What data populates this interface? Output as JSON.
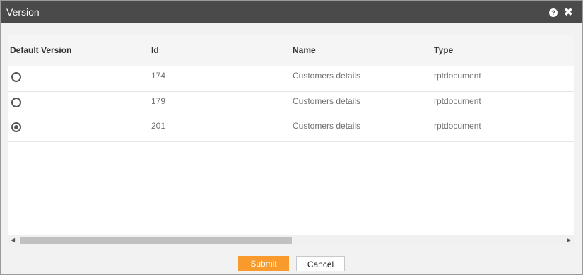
{
  "dialog": {
    "title": "Version",
    "help_glyph": "?",
    "close_glyph": "✖"
  },
  "table": {
    "columns": [
      "Default Version",
      "Id",
      "Name",
      "Type"
    ],
    "rows": [
      {
        "id": "174",
        "name": "Customers details",
        "type": "rptdocument",
        "default": false
      },
      {
        "id": "179",
        "name": "Customers details",
        "type": "rptdocument",
        "default": false
      },
      {
        "id": "201",
        "name": "Customers details",
        "type": "rptdocument",
        "default": true
      }
    ]
  },
  "scrollbar": {
    "left_arrow": "◀",
    "right_arrow": "▶"
  },
  "buttons": {
    "submit": "Submit",
    "cancel": "Cancel"
  },
  "colors": {
    "titlebar": "#4a4a4a",
    "submit": "#f89a2c"
  }
}
